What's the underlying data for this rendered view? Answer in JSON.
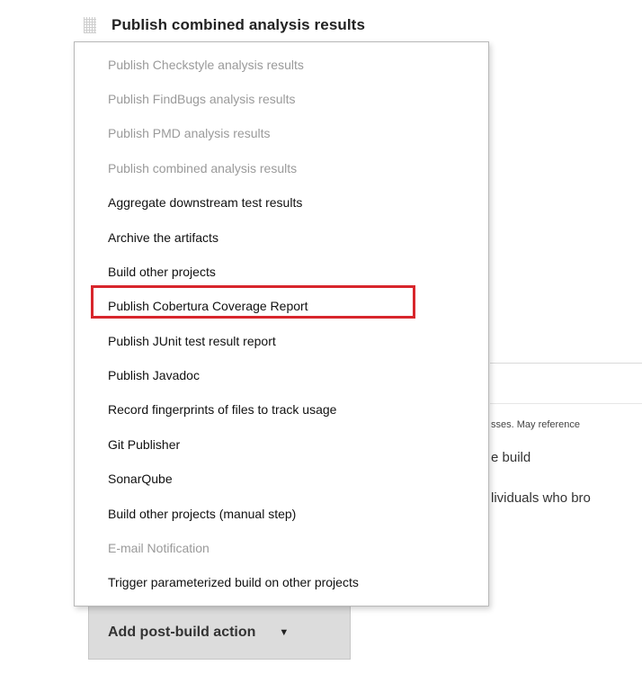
{
  "section": {
    "title": "Publish combined analysis results"
  },
  "background": {
    "hint_text": "sses. May reference",
    "line1": "e build",
    "line2": "lividuals who bro"
  },
  "menu": {
    "items": [
      {
        "label": "Publish Checkstyle analysis results",
        "disabled": true
      },
      {
        "label": "Publish FindBugs analysis results",
        "disabled": true
      },
      {
        "label": "Publish PMD analysis results",
        "disabled": true
      },
      {
        "label": "Publish combined analysis results",
        "disabled": true
      },
      {
        "label": "Aggregate downstream test results",
        "disabled": false
      },
      {
        "label": "Archive the artifacts",
        "disabled": false
      },
      {
        "label": "Build other projects",
        "disabled": false
      },
      {
        "label": "Publish Cobertura Coverage Report",
        "disabled": false,
        "highlighted": true
      },
      {
        "label": "Publish JUnit test result report",
        "disabled": false
      },
      {
        "label": "Publish Javadoc",
        "disabled": false
      },
      {
        "label": "Record fingerprints of files to track usage",
        "disabled": false
      },
      {
        "label": "Git Publisher",
        "disabled": false
      },
      {
        "label": "SonarQube",
        "disabled": false
      },
      {
        "label": "Build other projects (manual step)",
        "disabled": false
      },
      {
        "label": "E-mail Notification",
        "disabled": true
      },
      {
        "label": "Trigger parameterized build on other projects",
        "disabled": false
      }
    ]
  },
  "add_button": {
    "label": "Add post-build action",
    "caret_icon": "caret-down-icon"
  },
  "colors": {
    "highlight": "#d8262c",
    "disabled_text": "#9a9a9a",
    "button_bg": "#dcdcdc"
  }
}
